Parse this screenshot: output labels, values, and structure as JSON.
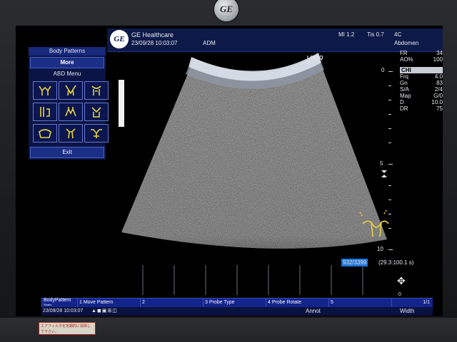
{
  "bezel": {
    "logo": "GE",
    "sticker_text": "エアフィルタを定期的に清掃して下さい。"
  },
  "header": {
    "logo": "GE",
    "company": "GE Healthcare",
    "datetime": "23/09/28 10:03:07",
    "operator": "ADM",
    "mi": "MI 1.2",
    "tis": "Tis 0.7",
    "probe": "4C",
    "preset": "Abdomen",
    "system": "LOGIQ\nV"
  },
  "menu": {
    "title": "Body Patterns",
    "more_label": "More",
    "submenu_title": "ABD Menu",
    "exit_label": "Exit",
    "icons": [
      "body-pattern-1-icon",
      "body-pattern-2-icon",
      "body-pattern-3-icon",
      "body-pattern-4-icon",
      "body-pattern-5-icon",
      "body-pattern-6-icon",
      "body-pattern-7-icon",
      "body-pattern-8-icon",
      "body-pattern-9-icon"
    ]
  },
  "params": {
    "fr_label": "FR",
    "fr_value": "34",
    "ao_label": "AO%",
    "ao_value": "100",
    "mode": "CHI",
    "rows": [
      {
        "label": "Frq",
        "value": "4.0"
      },
      {
        "label": "Gn",
        "value": "83"
      },
      {
        "label": "S/A",
        "value": "2/4"
      },
      {
        "label": "Map",
        "value": "G/0"
      },
      {
        "label": "D",
        "value": "10.0"
      },
      {
        "label": "DR",
        "value": "75"
      }
    ]
  },
  "depth_scale": {
    "top_label": "0",
    "mid_label": "5",
    "bottom_label": "10"
  },
  "cine": {
    "frame": "932/3399",
    "time": "(29.3:100.1 s)",
    "page": "1/1",
    "zero": "0"
  },
  "softkeys": [
    {
      "label": "BodyPattern",
      "sub": "Studio"
    },
    {
      "label": "1 Move Pattern"
    },
    {
      "label": "2"
    },
    {
      "label": "3 Probe Type"
    },
    {
      "label": "4 Probe Rotate"
    },
    {
      "label": "5"
    }
  ],
  "status": {
    "datetime": "23/09/28 10:03:07",
    "annot": "Annot",
    "width": "Width"
  },
  "colors": {
    "menu_bg": "#0a1545",
    "softkey_bg": "#13248a",
    "icon_yellow": "#e8d23a",
    "cine_highlight": "#1e74d8"
  }
}
